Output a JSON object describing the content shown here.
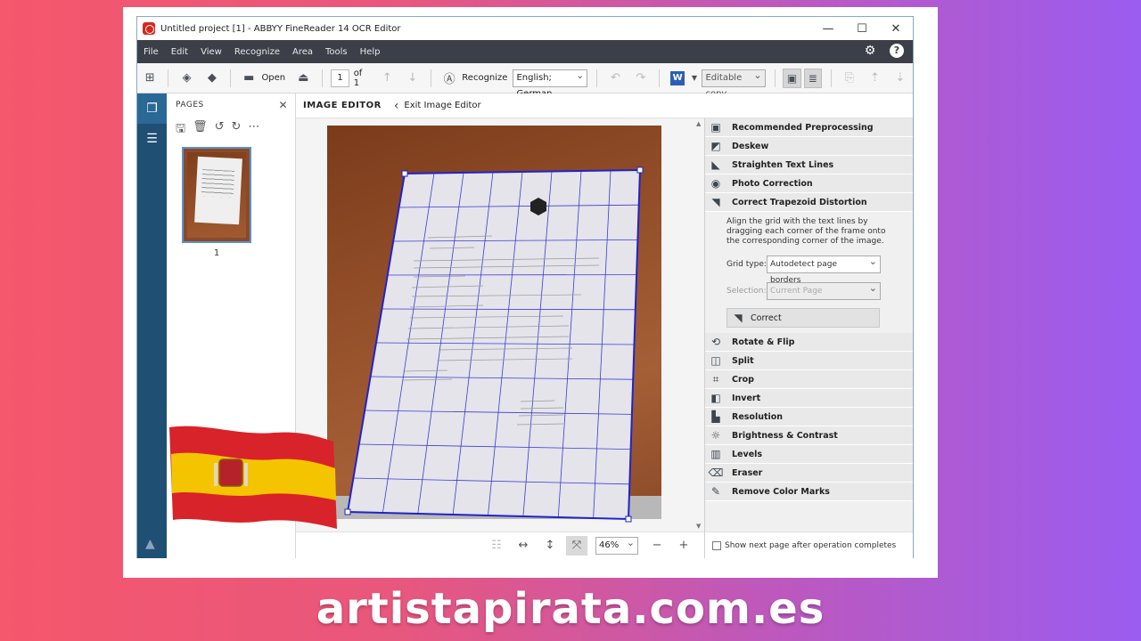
{
  "window": {
    "title": "Untitled project [1] - ABBYY FineReader 14 OCR Editor",
    "controls": {
      "minimize": "—",
      "maximize": "☐",
      "close": "✕"
    }
  },
  "menu": [
    "File",
    "Edit",
    "View",
    "Recognize",
    "Area",
    "Tools",
    "Help"
  ],
  "toolbar": {
    "open_label": "Open",
    "page_current": "1",
    "page_of": "of 1",
    "recognize_label": "Recognize",
    "language": "English; German",
    "output_mode": "Editable copy"
  },
  "pages_panel": {
    "title": "PAGES",
    "page_number": "1"
  },
  "editor": {
    "title": "IMAGE EDITOR",
    "exit_label": "Exit Image Editor"
  },
  "zoom": {
    "value": "46%"
  },
  "tools_top": [
    {
      "label": "Recommended Preprocessing",
      "icon": "preprocess-icon"
    },
    {
      "label": "Deskew",
      "icon": "deskew-icon"
    },
    {
      "label": "Straighten Text Lines",
      "icon": "straighten-icon"
    },
    {
      "label": "Photo Correction",
      "icon": "camera-icon"
    },
    {
      "label": "Correct Trapezoid Distortion",
      "icon": "trapezoid-icon"
    }
  ],
  "trapezoid": {
    "description": "Align the grid with the text lines by dragging each corner of the frame onto the corresponding corner of the image.",
    "grid_type_label": "Grid type:",
    "grid_type_value": "Autodetect page borders",
    "selection_label": "Selection:",
    "selection_value": "Current Page",
    "correct_label": "Correct"
  },
  "tools_bottom": [
    {
      "label": "Rotate & Flip",
      "icon": "rotate-icon"
    },
    {
      "label": "Split",
      "icon": "split-icon"
    },
    {
      "label": "Crop",
      "icon": "crop-icon"
    },
    {
      "label": "Invert",
      "icon": "invert-icon"
    },
    {
      "label": "Resolution",
      "icon": "resolution-icon"
    },
    {
      "label": "Brightness & Contrast",
      "icon": "brightness-icon"
    },
    {
      "label": "Levels",
      "icon": "levels-icon"
    },
    {
      "label": "Eraser",
      "icon": "eraser-icon"
    },
    {
      "label": "Remove Color Marks",
      "icon": "color-marks-icon"
    }
  ],
  "footer": {
    "show_next_page_label": "Show next page after operation completes"
  },
  "watermark": "artistapirata.com.es",
  "colors": {
    "menubar": "#3b3f47",
    "sidebar": "#1f4f73",
    "grid_line": "#3b3bd6",
    "accent_red": "#d9261c"
  }
}
